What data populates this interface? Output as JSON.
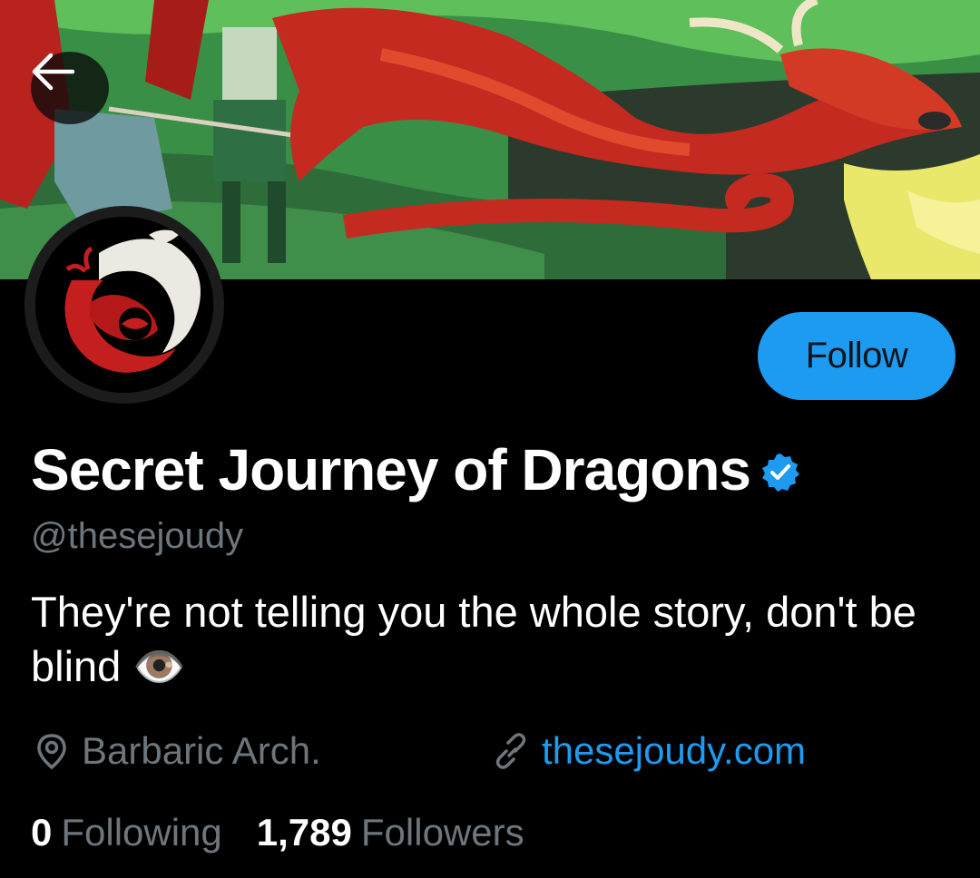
{
  "profile": {
    "display_name": "Secret Journey of Dragons",
    "handle": "@thesejoudy",
    "bio": "They're not telling you the whole story, don't be blind 👁️",
    "location": "Barbaric Arch.",
    "website": "thesejoudy.com",
    "verified": true
  },
  "actions": {
    "follow_label": "Follow",
    "back_icon": "arrow-left-icon"
  },
  "stats": {
    "following_count": "0",
    "following_label": "Following",
    "followers_count": "1,789",
    "followers_label": "Followers"
  },
  "icons": {
    "location": "map-pin-icon",
    "link": "link-icon",
    "verified": "verified-badge-icon"
  },
  "colors": {
    "background": "#000000",
    "accent": "#1d9bf0",
    "secondary_text": "#6e767d",
    "primary_text": "#ffffff"
  }
}
